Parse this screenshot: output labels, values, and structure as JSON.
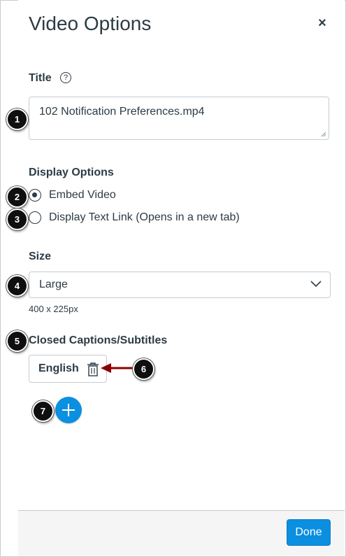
{
  "dialog": {
    "title": "Video Options",
    "close_icon": "close-icon",
    "close_glyph": "×"
  },
  "title_field": {
    "label": "Title",
    "help_glyph": "?",
    "value": "102 Notification Preferences.mp4"
  },
  "display_options": {
    "label": "Display Options",
    "options": [
      {
        "label": "Embed Video",
        "checked": true
      },
      {
        "label": "Display Text Link (Opens in a new tab)",
        "checked": false
      }
    ]
  },
  "size": {
    "label": "Size",
    "selected": "Large",
    "dimensions": "400 x 225px"
  },
  "captions": {
    "label": "Closed Captions/Subtitles",
    "tracks": [
      {
        "language": "English"
      }
    ]
  },
  "footer": {
    "done_label": "Done"
  },
  "annotations": [
    "1",
    "2",
    "3",
    "4",
    "5",
    "6",
    "7"
  ],
  "colors": {
    "primary": "#0b8fe0",
    "text": "#2d3b45",
    "border": "#c7cdd1",
    "annotation_arrow": "#8b0000"
  }
}
